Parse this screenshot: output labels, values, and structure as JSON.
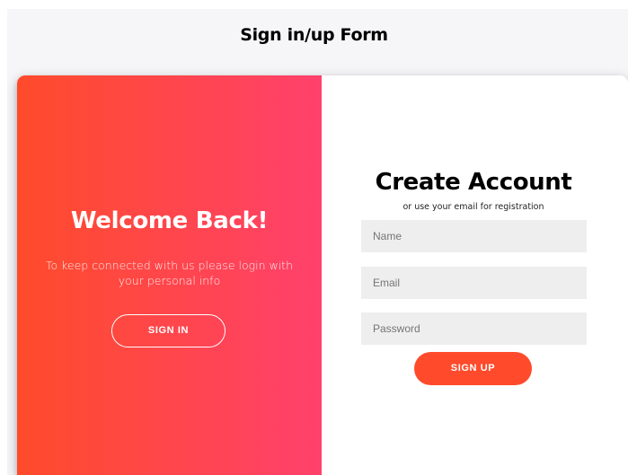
{
  "page": {
    "heading": "Sign in/up Form"
  },
  "overlay": {
    "title": "Welcome Back!",
    "text": "To keep connected with us please login with your personal info",
    "sign_in_label": "SIGN IN",
    "gradient_start": "#ff4b2b",
    "gradient_end": "#ff416c"
  },
  "signup_form": {
    "title": "Create Account",
    "subtitle": "or use your email for registration",
    "name_placeholder": "Name",
    "email_placeholder": "Email",
    "password_placeholder": "Password",
    "submit_label": "SIGN UP",
    "accent_color": "#ff4b2b"
  }
}
